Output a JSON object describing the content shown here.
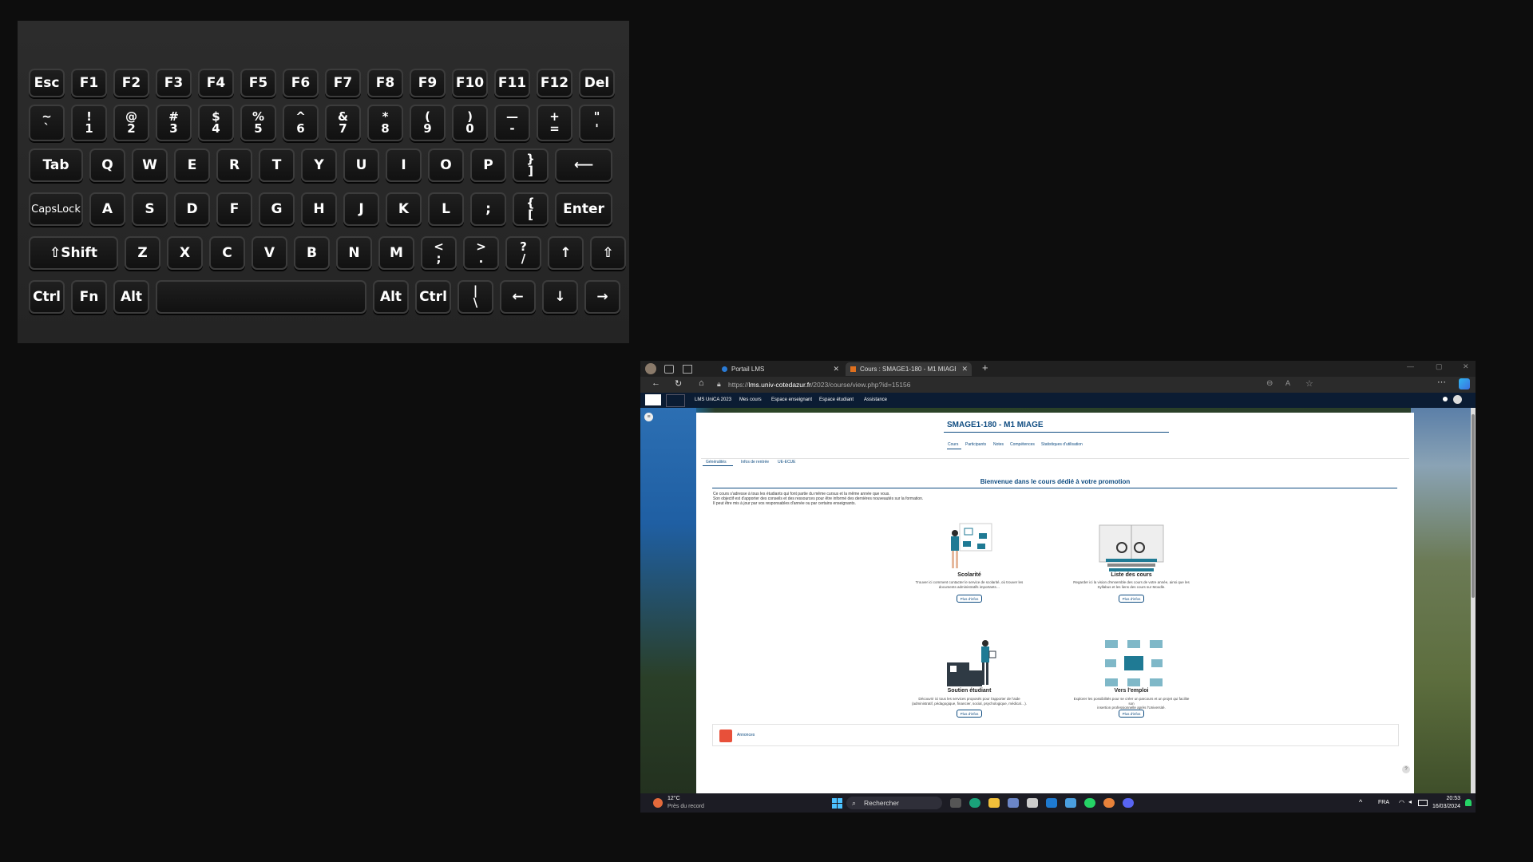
{
  "keyboard": {
    "row0": [
      "Esc",
      "F1",
      "F2",
      "F3",
      "F4",
      "F5",
      "F6",
      "F7",
      "F8",
      "F9",
      "F10",
      "F11",
      "F12",
      "Del"
    ],
    "row1": [
      [
        "~",
        "`"
      ],
      [
        "!",
        "1"
      ],
      [
        "@",
        "2"
      ],
      [
        "#",
        "3"
      ],
      [
        "$",
        "4"
      ],
      [
        "%",
        "5"
      ],
      [
        "^",
        "6"
      ],
      [
        "&",
        "7"
      ],
      [
        "*",
        "8"
      ],
      [
        "(",
        "9"
      ],
      [
        ")",
        "0"
      ],
      [
        "—",
        "-"
      ],
      [
        "+",
        "="
      ],
      [
        "\"",
        "'"
      ]
    ],
    "row2": [
      "Tab",
      "Q",
      "W",
      "E",
      "R",
      "T",
      "Y",
      "U",
      "I",
      "O",
      "P",
      [
        "}",
        "]"
      ],
      "⟵"
    ],
    "row3": [
      "CapsLock",
      "A",
      "S",
      "D",
      "F",
      "G",
      "H",
      "J",
      "K",
      "L",
      ";",
      [
        "{",
        "["
      ],
      "Enter"
    ],
    "row4": [
      "⇧Shift",
      "Z",
      "X",
      "C",
      "V",
      "B",
      "N",
      "M",
      [
        "<",
        ";"
      ],
      [
        ">",
        "."
      ],
      [
        "?",
        "/"
      ],
      "↑",
      "⇧"
    ],
    "row5": [
      "Ctrl",
      "Fn",
      "Alt",
      "",
      "Alt",
      "Ctrl",
      [
        "|",
        "\\"
      ],
      "←",
      "↓",
      "→"
    ]
  },
  "browser": {
    "tabs": [
      {
        "label": "Portail LMS"
      },
      {
        "label": "Cours : SMAGE1-180 - M1 MIAGE"
      }
    ],
    "url_prefix": "https://",
    "url_host": "lms.univ-cotedazur.fr",
    "url_path": "/2023/course/view.php?id=15156"
  },
  "moodle": {
    "site_name": "LMS UniCA 2023",
    "menu": [
      "Mes cours",
      "Espace enseignant",
      "Espace étudiant",
      "Assistance"
    ]
  },
  "course": {
    "title": "SMAGE1-180 - M1 MIAGE",
    "nav": [
      "Cours",
      "Participants",
      "Notes",
      "Compétences",
      "Statistiques d'utilisation"
    ],
    "subnav": [
      "Généralités",
      "Infos de rentrée",
      "UE-ECUE"
    ],
    "welcome": "Bienvenue dans le cours dédié à votre promotion",
    "intro": [
      "Ce cours s'adresse à tous les étudiants qui font partie du même cursus et la même année que vous.",
      "Son objectif est d'apporter des conseils et des ressources pour être informé des dernières nouveautés sur la formation.",
      "Il peut être mis à jour par vos responsables d'année ou par certains enseignants."
    ],
    "tiles": [
      {
        "title": "Scolarité",
        "desc1": "Trouver ici comment contacter le service de scolarité, où trouver les",
        "desc2": "documents administratifs importants…",
        "button": "Plus d'infos"
      },
      {
        "title": "Liste des cours",
        "desc1": "Regarder ici la vision d'ensemble des cours de votre année, ainsi que les",
        "desc2": "Syllabus et les liens des cours sur Moodle.",
        "button": "Plus d'infos"
      },
      {
        "title": "Soutien étudiant",
        "desc1": "Découvrir ici tous les services proposés pour t'apporter de l'aide",
        "desc2": "(administratif, pédagogique, financier, social, psychologique, médical…).",
        "button": "Plus d'infos"
      },
      {
        "title": "Vers l'emploi",
        "desc1": "Explorer les possibilités pour se créer un parcours et un projet qui facilite son",
        "desc2": "insertion professionnelle après l'Université.",
        "button": "Plus d'infos"
      }
    ],
    "announcements": "Annonces"
  },
  "taskbar": {
    "temperature": "12°C",
    "weather": "Près du record",
    "search": "Rechercher",
    "lang": "FRA",
    "time": "20:53",
    "date": "16/03/2024"
  }
}
